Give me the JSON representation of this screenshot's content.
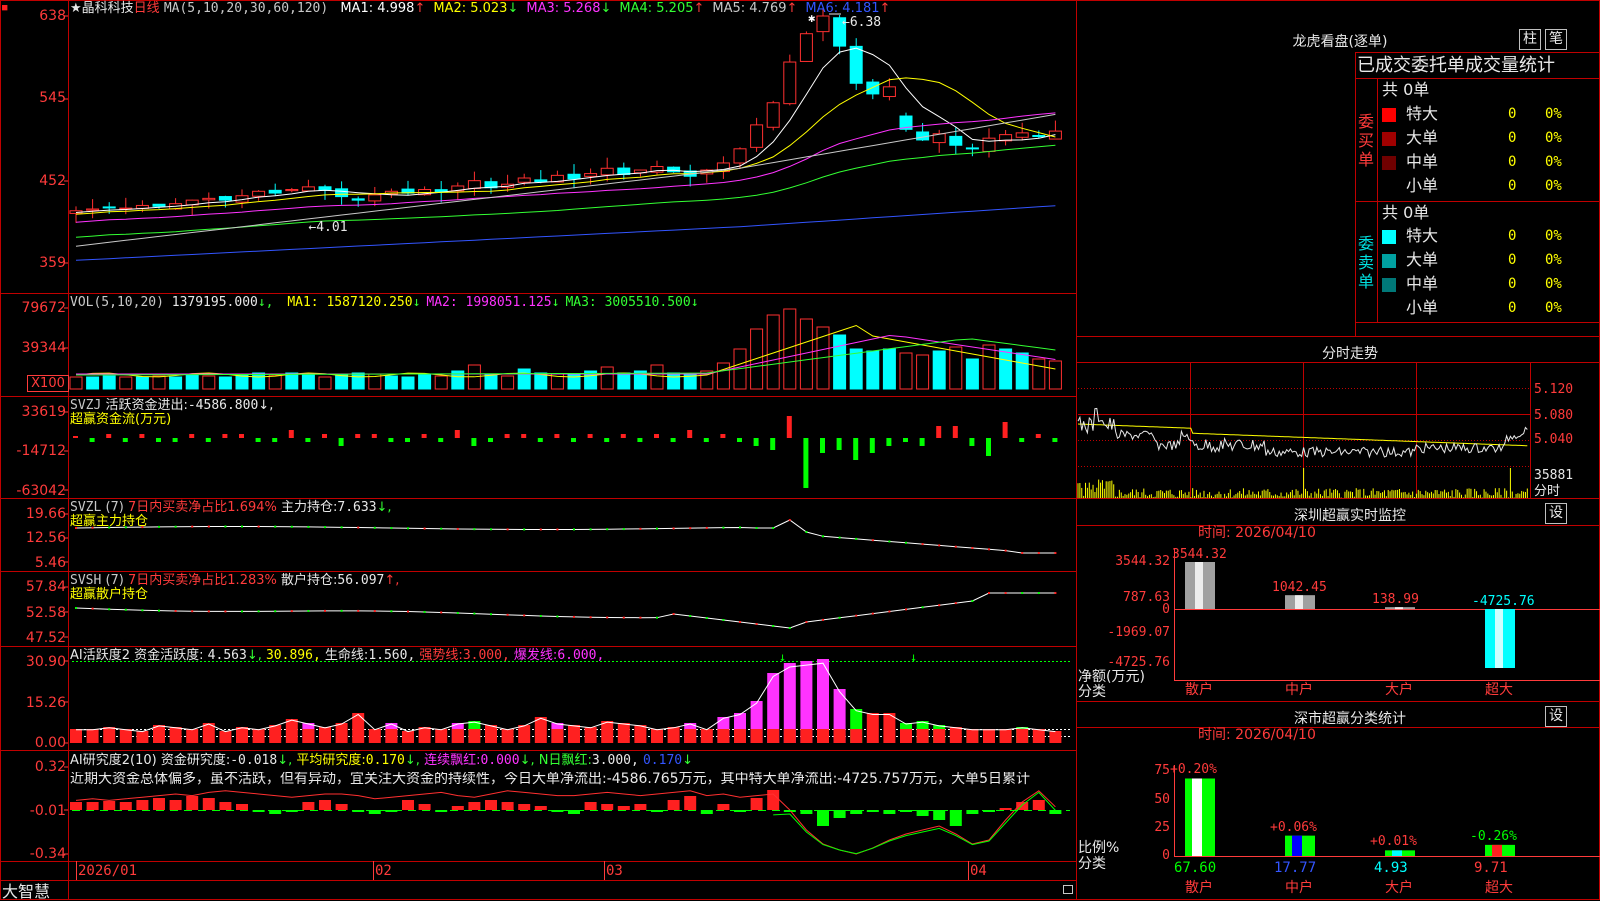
{
  "app": {
    "brand": "大智慧",
    "corner_mark": "■"
  },
  "price_panel": {
    "title": "★晶科科技",
    "period": "日线",
    "ma_def": "MA(5,10,20,30,60,120)",
    "ma": [
      {
        "label": "MA1:",
        "value": "4.998",
        "arrow": "↑",
        "color": "#ffffff"
      },
      {
        "label": "MA2:",
        "value": "5.023",
        "arrow": "↓",
        "color": "#ffff00"
      },
      {
        "label": "MA3:",
        "value": "5.268",
        "arrow": "↓",
        "color": "#ff33ff"
      },
      {
        "label": "MA4:",
        "value": "5.205",
        "arrow": "↑",
        "color": "#33ff33"
      },
      {
        "label": "MA5:",
        "value": "4.769",
        "arrow": "↑",
        "color": "#c8c8c8"
      },
      {
        "label": "MA6:",
        "value": "4.181",
        "arrow": "↑",
        "color": "#3355ff"
      }
    ],
    "y_ticks": [
      "638",
      "545",
      "452",
      "359"
    ],
    "high_label": "6.38",
    "low_label": "4.01"
  },
  "vol_panel": {
    "title": "VOL(5,10,20)",
    "value": "1379195.000",
    "ma": [
      {
        "label": "MA1:",
        "value": "1587120.250",
        "arrow": "↓",
        "color": "#ffff00"
      },
      {
        "label": "MA2:",
        "value": "1998051.125",
        "arrow": "↓",
        "color": "#ff33ff"
      },
      {
        "label": "MA3:",
        "value": "3005510.500",
        "arrow": "↓",
        "color": "#33ff33"
      }
    ],
    "y_ticks": [
      "79672",
      "39344"
    ],
    "unit": "X100"
  },
  "svzj_panel": {
    "title": "SVZJ",
    "label": "活跃资金进出:",
    "value": "-4586.800",
    "arrow": "↓,",
    "subtitle": "超赢资金流(万元)",
    "y_ticks": [
      "33619",
      "-14712",
      "-63042"
    ]
  },
  "svzl_panel": {
    "title": "SVZL",
    "param": "(7)",
    "desc": "7日内买卖净占比1.694%",
    "label": "主力持仓:",
    "value": "7.633",
    "arrow": "↓,",
    "subtitle": "超赢主力持仓",
    "y_ticks": [
      "19.66",
      "12.56",
      "5.46"
    ]
  },
  "svsh_panel": {
    "title": "SVSH",
    "param": "(7)",
    "desc": "7日内买卖净占比1.283%",
    "label": "散户持仓:",
    "value": "56.097",
    "arrow": "↑,",
    "subtitle": "超赢散户持仓",
    "y_ticks": [
      "57.84",
      "52.58",
      "47.52"
    ]
  },
  "ai_active_panel": {
    "title": "AI活跃度2",
    "label": "资金活跃度:",
    "value": "4.563",
    "arrow": "↓,",
    "v2": "30.896,",
    "life_label": "生命线:",
    "life_value": "1.560,",
    "strong_label": "强势线:",
    "strong_value": "3.000,",
    "burst_label": "爆发线:",
    "burst_value": "6.000,",
    "y_ticks": [
      "30.90",
      "15.26",
      "0.00"
    ]
  },
  "ai_research_panel": {
    "title": "AI研究度2(10)",
    "label": "资金研究度:",
    "value": "-0.018",
    "arrow": "↓,",
    "avg_label": "平均研究度:",
    "avg_value": "0.170",
    "avg_arrow": "↓,",
    "lh_label": "连续飘红:",
    "lh_value": "0.000",
    "lh_arrow": "↓,",
    "nh_label": "N日飘红:",
    "nh_value": "3.000,",
    "extra_value": "0.170",
    "extra_arrow": "↓",
    "comment": "近期大资金总体偏多，虽不活跃，但有异动，宜关注大资金的持续性，今日大单净流出:-4586.765万元，其中特大单净流出:-4725.757万元，大单5日累计",
    "y_ticks": [
      "0.32",
      "-0.01",
      "-0.34"
    ]
  },
  "x_axis": {
    "labels": [
      "2026/01",
      "02",
      "03",
      "04"
    ]
  },
  "lhb": {
    "title": "龙虎看盘(逐单)",
    "btn_zhu": "柱",
    "btn_bi": "笔",
    "header": "已成交委托单成交量统计",
    "buy": {
      "side_label": "委买单",
      "total": "共 0单",
      "rows": [
        {
          "name": "特大",
          "count": "0",
          "pct": "0%",
          "color": "#ff0000"
        },
        {
          "name": "大单",
          "count": "0",
          "pct": "0%",
          "color": "#a00000"
        },
        {
          "name": "中单",
          "count": "0",
          "pct": "0%",
          "color": "#700000"
        },
        {
          "name": "小单",
          "count": "0",
          "pct": "0%",
          "color": ""
        }
      ]
    },
    "sell": {
      "side_label": "委卖单",
      "total": "共 0单",
      "rows": [
        {
          "name": "特大",
          "count": "0",
          "pct": "0%",
          "color": "#00ffff"
        },
        {
          "name": "大单",
          "count": "0",
          "pct": "0%",
          "color": "#00a0a0"
        },
        {
          "name": "中单",
          "count": "0",
          "pct": "0%",
          "color": "#007878"
        },
        {
          "name": "小单",
          "count": "0",
          "pct": "0%",
          "color": ""
        }
      ]
    }
  },
  "intraday": {
    "title": "分时走势",
    "y_ticks": [
      "5.120",
      "5.080",
      "5.040"
    ],
    "vol_label": "35881",
    "vol_unit": "分时"
  },
  "sz_monitor": {
    "title": "深圳超赢实时监控",
    "btn": "设",
    "time": "时间: 2026/04/10",
    "y_ticks": [
      "3544.32",
      "787.63",
      "0",
      "-1969.07",
      "-4725.76"
    ],
    "y_title": "净额(万元)",
    "x_title": "分类",
    "categories": [
      "散户",
      "中户",
      "大户",
      "超大"
    ],
    "values": [
      3544.32,
      1042.45,
      138.99,
      -4725.76
    ],
    "value_labels": [
      "3544.32",
      "1042.45",
      "138.99",
      "-4725.76"
    ]
  },
  "sz_category": {
    "title": "深市超赢分类统计",
    "btn": "设",
    "time": "时间: 2026/04/10",
    "y_ticks": [
      "75",
      "50",
      "25",
      "0"
    ],
    "y_title": "比例%",
    "x_title": "分类",
    "categories": [
      "散户",
      "中户",
      "大户",
      "超大"
    ],
    "proportions": [
      67.6,
      17.77,
      4.93,
      9.71
    ],
    "proportion_labels": [
      "67.60",
      "17.77",
      "4.93",
      "9.71"
    ],
    "changes": [
      0.2,
      0.06,
      0.01,
      -0.26
    ],
    "change_labels": [
      "+0.20%",
      "+0.06%",
      "+0.01%",
      "-0.26%"
    ]
  }
}
